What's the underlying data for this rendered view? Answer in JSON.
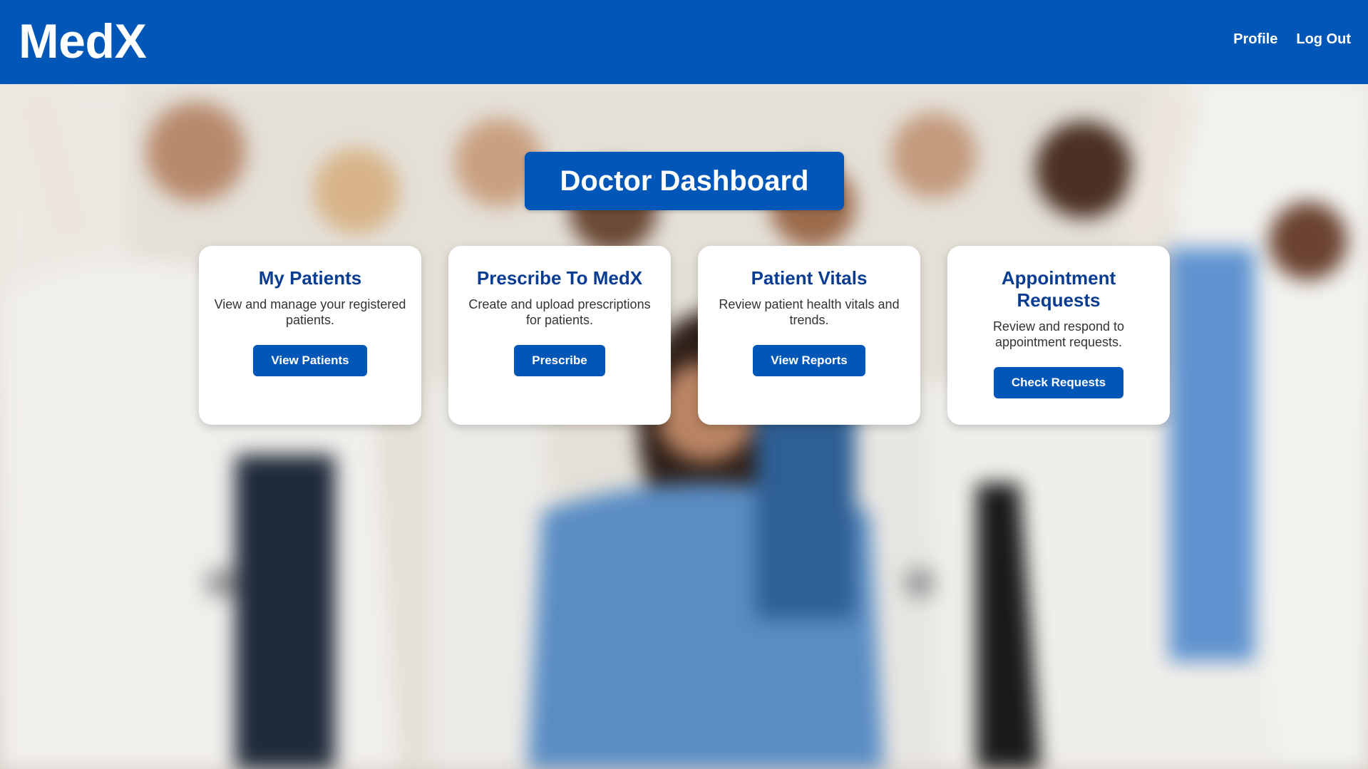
{
  "header": {
    "logo": "MedX",
    "nav": [
      {
        "label": "Profile"
      },
      {
        "label": "Log Out"
      }
    ]
  },
  "main": {
    "title": "Doctor Dashboard",
    "cards": [
      {
        "title": "My Patients",
        "description": "View and manage your registered patients.",
        "button": "View Patients"
      },
      {
        "title": "Prescribe To MedX",
        "description": "Create and upload prescriptions for patients.",
        "button": "Prescribe"
      },
      {
        "title": "Patient Vitals",
        "description": "Review patient health vitals and trends.",
        "button": "View Reports"
      },
      {
        "title": "Appointment Requests",
        "description": "Review and respond to appointment requests.",
        "button": "Check Requests"
      }
    ]
  },
  "colors": {
    "brand": "#0057b8",
    "card_title": "#0a3d91",
    "card_bg": "#ffffff"
  },
  "background": {
    "image": "blurred-photo-medical-staff-celebrating"
  }
}
